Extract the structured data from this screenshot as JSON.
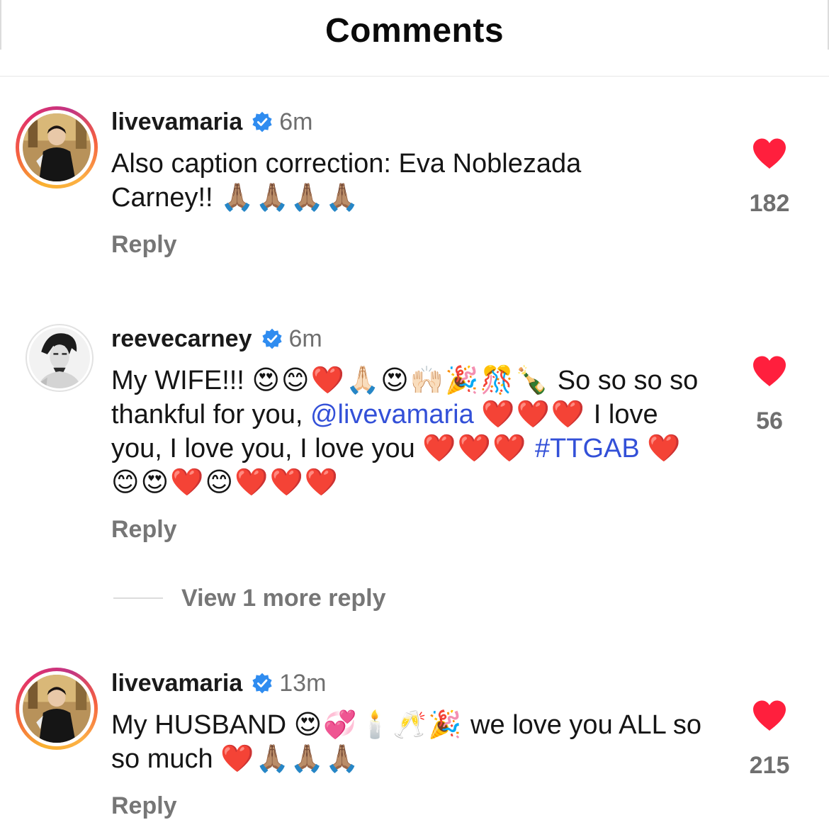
{
  "header": {
    "title": "Comments"
  },
  "colors": {
    "like": "#ff1f3d",
    "verified": "#2f8cf0",
    "link": "#3350d8",
    "muted": "#767676"
  },
  "comments": [
    {
      "username": "livevamaria",
      "verified": true,
      "time": "6m",
      "text": "Also caption correction: Eva Noblezada Carney!!",
      "emojis": "🙏🏽🙏🏽🙏🏽🙏🏽",
      "likes": "182",
      "reply_label": "Reply",
      "avatar": "story-ring-avatar"
    },
    {
      "username": "reevecarney",
      "verified": true,
      "time": "6m",
      "text_a": "My WIFE!!!",
      "emojis_a": "😍😊❤️🙏🏻😍🙌🏻🎉🎊🍾",
      "text_b": "So so so so thankful for you,",
      "mention": "@livevamaria",
      "emojis_b": "❤️❤️❤️",
      "text_c": "I love you, I love you, I love you",
      "emojis_c": "❤️❤️❤️",
      "hashtag": "#TTGAB",
      "emojis_d": "❤️😊😍❤️😊❤️❤️❤️",
      "likes": "56",
      "reply_label": "Reply",
      "avatar": "plain-avatar",
      "view_more": "View 1 more reply"
    },
    {
      "username": "livevamaria",
      "verified": true,
      "time": "13m",
      "text_a": "My HUSBAND",
      "emojis_a": "😍💞🕯️🥂🎉",
      "text_b": "we love you ALL so so much",
      "emojis_b": "❤️🙏🏽🙏🏽🙏🏽",
      "likes": "215",
      "reply_label": "Reply",
      "avatar": "story-ring-avatar"
    }
  ]
}
